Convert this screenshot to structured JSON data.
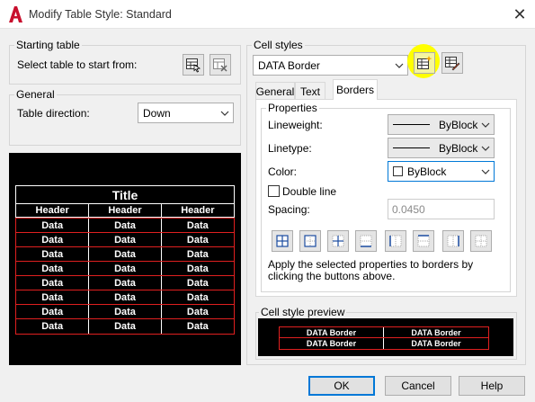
{
  "window": {
    "title": "Modify Table Style: Standard",
    "close_glyph": "✕"
  },
  "starting_table": {
    "group_label": "Starting table",
    "prompt": "Select table to start from:"
  },
  "general": {
    "group_label": "General",
    "direction_label": "Table direction:",
    "direction_value": "Down"
  },
  "table_preview": {
    "title": "Title",
    "headers": [
      "Header",
      "Header",
      "Header"
    ],
    "data_rows": [
      [
        "Data",
        "Data",
        "Data"
      ],
      [
        "Data",
        "Data",
        "Data"
      ],
      [
        "Data",
        "Data",
        "Data"
      ],
      [
        "Data",
        "Data",
        "Data"
      ],
      [
        "Data",
        "Data",
        "Data"
      ],
      [
        "Data",
        "Data",
        "Data"
      ],
      [
        "Data",
        "Data",
        "Data"
      ],
      [
        "Data",
        "Data",
        "Data"
      ]
    ]
  },
  "cell_styles": {
    "group_label": "Cell styles",
    "selected": "DATA Border",
    "tabs": [
      "General",
      "Text",
      "Borders"
    ],
    "active_tab": "Borders"
  },
  "properties": {
    "group_label": "Properties",
    "lineweight_label": "Lineweight:",
    "lineweight_value": "ByBlock",
    "linetype_label": "Linetype:",
    "linetype_value": "ByBlock",
    "color_label": "Color:",
    "color_value": "ByBlock",
    "double_line_label": "Double line",
    "spacing_label": "Spacing:",
    "spacing_value": "0.0450",
    "help_text": "Apply the selected properties to borders by clicking the buttons above."
  },
  "cell_style_preview": {
    "group_label": "Cell style preview",
    "rows": [
      [
        "DATA Border",
        "DATA Border"
      ],
      [
        "DATA Border",
        "DATA Border"
      ]
    ]
  },
  "footer": {
    "ok": "OK",
    "cancel": "Cancel",
    "help": "Help"
  },
  "colors": {
    "highlight": "#ffff00",
    "accent": "#0078d7",
    "red_border": "#e02020",
    "app_red": "#c8102e"
  }
}
